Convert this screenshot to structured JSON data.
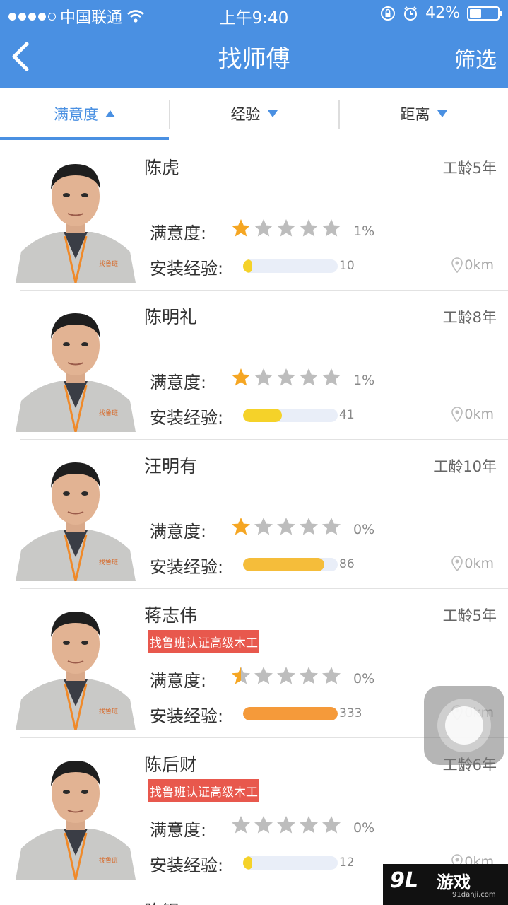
{
  "status_bar": {
    "carrier": "中国联通",
    "time": "上午9:40",
    "battery": "42%",
    "battery_level": 0.42
  },
  "nav": {
    "back_icon": "chevron-left-icon",
    "title": "找师傅",
    "filter_label": "筛选"
  },
  "tabs": [
    {
      "label": "满意度",
      "active": true,
      "arrow": "up"
    },
    {
      "label": "经验",
      "active": false,
      "arrow": "down"
    },
    {
      "label": "距离",
      "active": false,
      "arrow": "down"
    }
  ],
  "workers": [
    {
      "name": "陈虎",
      "years": "工龄5年",
      "cert": "",
      "sat_label": "满意度:",
      "rating": 1,
      "sat_pct": "1%",
      "exp_label": "安装经验:",
      "exp_value": "10",
      "exp_fraction": 0.08,
      "bar_color": "#f5d229",
      "distance": "0km"
    },
    {
      "name": "陈明礼",
      "years": "工龄8年",
      "cert": "",
      "sat_label": "满意度:",
      "rating": 1,
      "sat_pct": "1%",
      "exp_label": "安装经验:",
      "exp_value": "41",
      "exp_fraction": 0.41,
      "bar_color": "#f5d229",
      "distance": "0km"
    },
    {
      "name": "汪明有",
      "years": "工龄10年",
      "cert": "",
      "sat_label": "满意度:",
      "rating": 1,
      "sat_pct": "0%",
      "exp_label": "安装经验:",
      "exp_value": "86",
      "exp_fraction": 0.86,
      "bar_color": "#f5bd3a",
      "distance": "0km"
    },
    {
      "name": "蒋志伟",
      "years": "工龄5年",
      "cert": "找鲁班认证高级木工",
      "sat_label": "满意度:",
      "rating": 0.5,
      "sat_pct": "0%",
      "exp_label": "安装经验:",
      "exp_value": "333",
      "exp_fraction": 1.0,
      "bar_color": "#f59a3a",
      "distance": "0km"
    },
    {
      "name": "陈后财",
      "years": "工龄6年",
      "cert": "找鲁班认证高级木工",
      "sat_label": "满意度:",
      "rating": 0,
      "sat_pct": "0%",
      "exp_label": "安装经验:",
      "exp_value": "12",
      "exp_fraction": 0.1,
      "bar_color": "#f5d229",
      "distance": "0km"
    }
  ],
  "partial_next_name": "陈银",
  "colors": {
    "primary": "#4a90e2",
    "star_filled": "#f5a623",
    "star_empty": "#bdbdbd",
    "cert_bg": "#e8584d"
  },
  "watermark": {
    "logo": "9L",
    "brand": "游戏",
    "site": "91danji.com"
  }
}
